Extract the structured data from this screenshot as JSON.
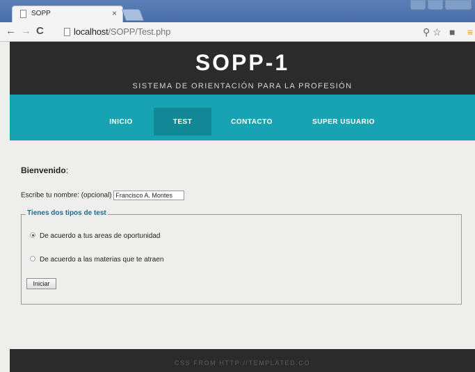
{
  "browser": {
    "tab_title": "SOPP",
    "tab_close": "×",
    "url_host": "localhost",
    "url_path": "/SOPP/Test.php"
  },
  "header": {
    "title": "SOPP-1",
    "subtitle": "SISTEMA DE ORIENTACIÓN PARA LA PROFESIÓN"
  },
  "nav": {
    "items": [
      {
        "label": "INICIO"
      },
      {
        "label": "TEST",
        "active": true
      },
      {
        "label": "CONTACTO"
      },
      {
        "label": "SUPER USUARIO"
      }
    ]
  },
  "main": {
    "welcome": "Bienvenido",
    "welcome_suffix": ":",
    "name_label": "Escribe tu nombre: (opcional)",
    "name_value": "Francisco A. Montes",
    "legend": "Tienes dos tipos de test",
    "options": [
      {
        "label": "De acuerdo a tus areas de oportunidad",
        "checked": true
      },
      {
        "label": "De acuerdo a las materias que te atraen",
        "checked": false
      }
    ],
    "submit_label": "Iniciar"
  },
  "footer": {
    "text": "CSS FROM HTTP://TEMPLATED.CO"
  },
  "colors": {
    "header_bg": "#2b2b2b",
    "nav_bg": "#17a3b2",
    "nav_active": "#128896",
    "legend_color": "#1f6a90"
  }
}
